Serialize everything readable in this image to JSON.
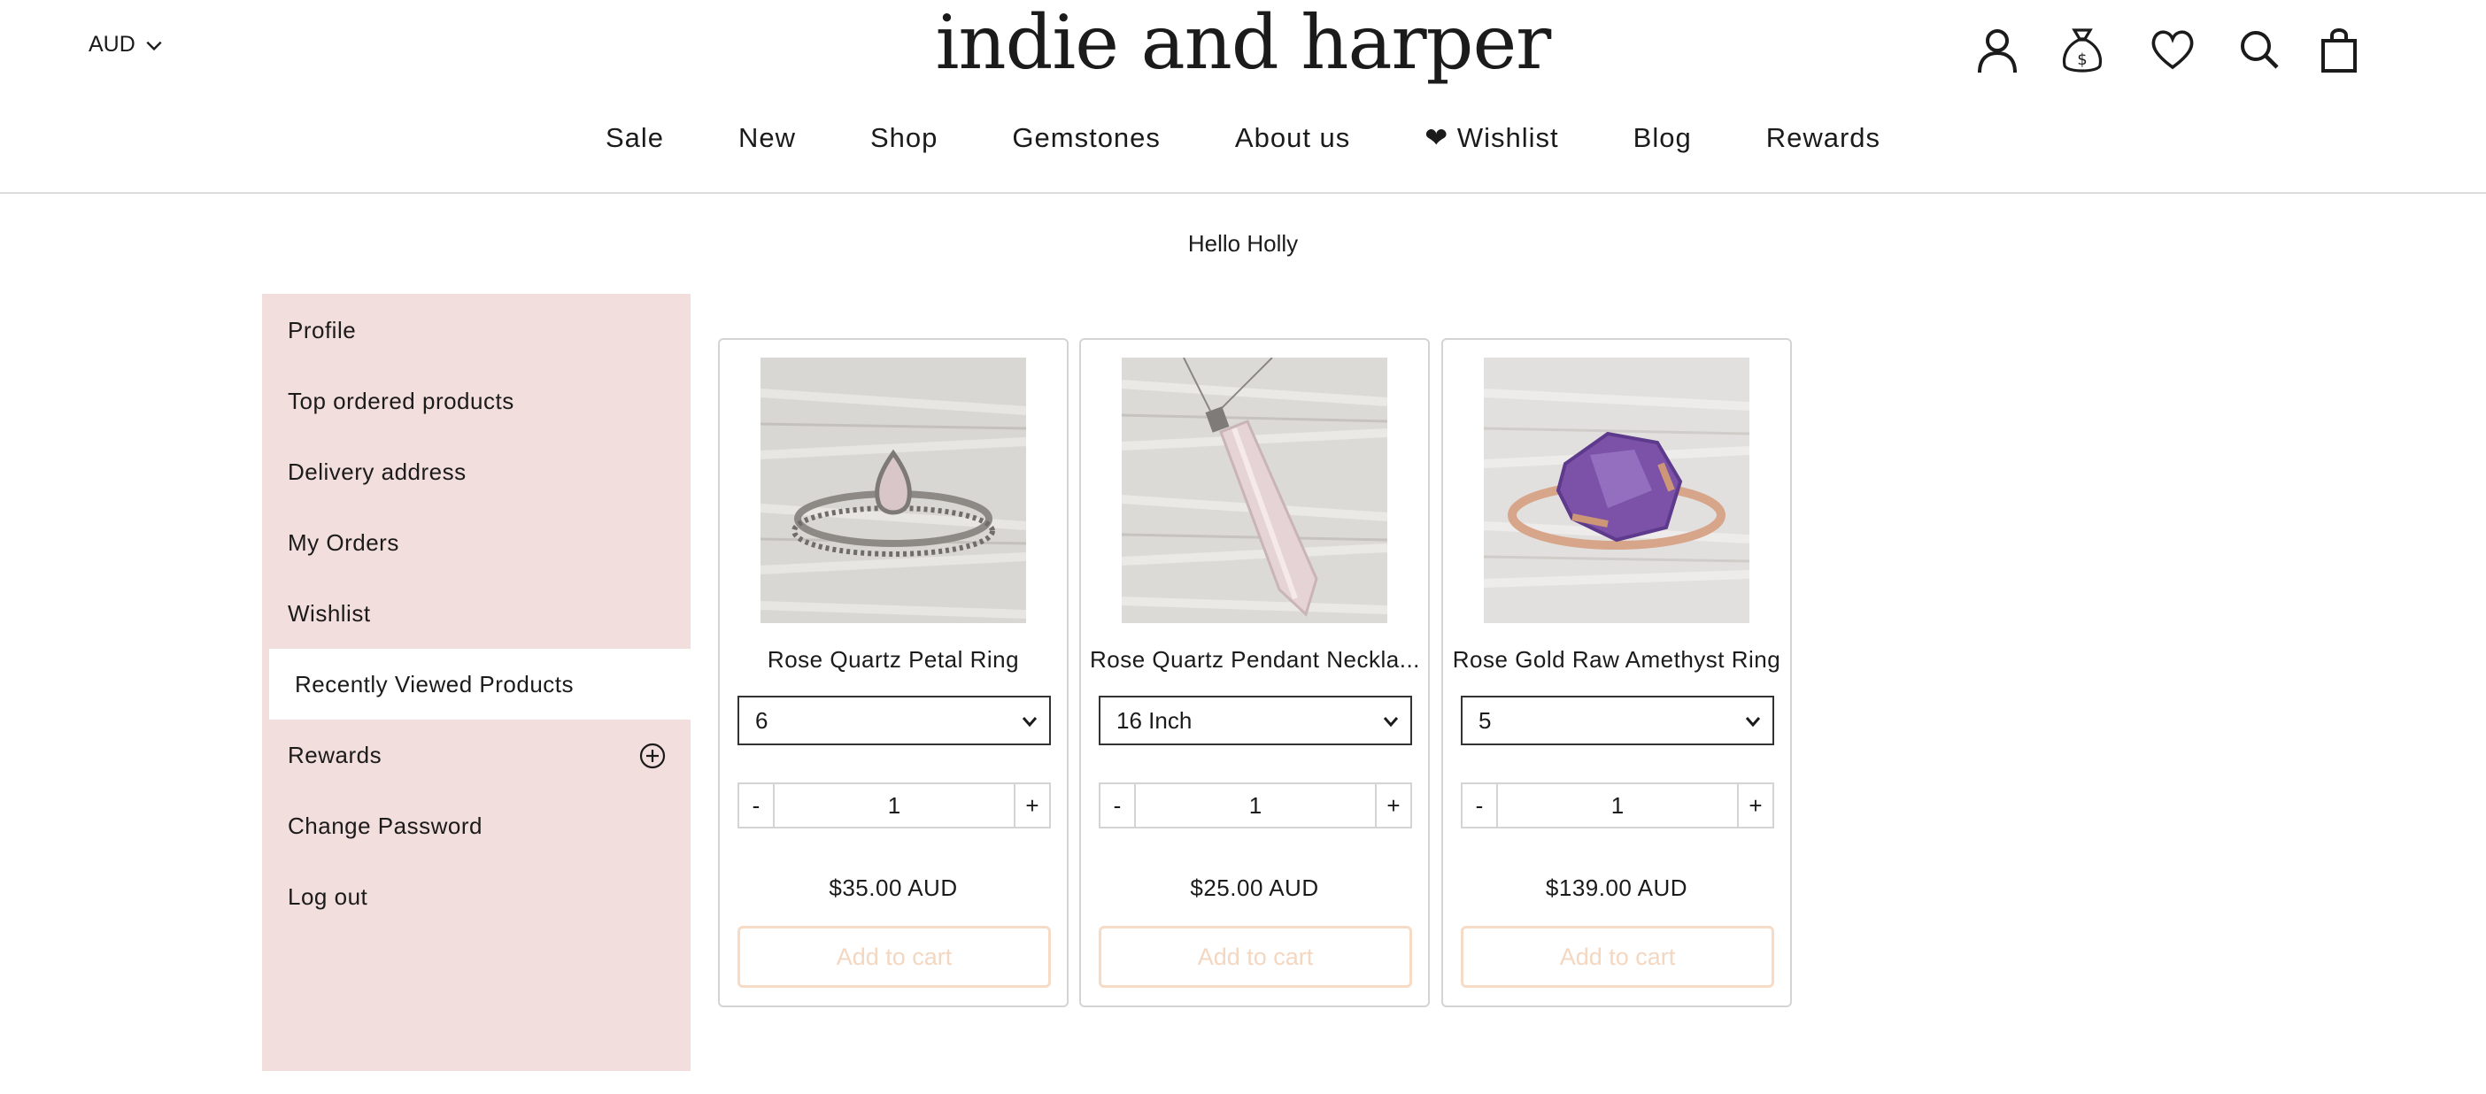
{
  "header": {
    "currency": "AUD",
    "logo": "indie and harper",
    "icons": [
      "account-icon",
      "money-bag-icon",
      "heart-icon",
      "search-icon",
      "shopping-bag-icon"
    ]
  },
  "nav": {
    "items": [
      "Sale",
      "New",
      "Shop",
      "Gemstones",
      "About us",
      "❤ Wishlist",
      "Blog",
      "Rewards"
    ]
  },
  "greeting": "Hello Holly",
  "sidebar": {
    "items": [
      {
        "label": "Profile"
      },
      {
        "label": "Top ordered products"
      },
      {
        "label": "Delivery address"
      },
      {
        "label": "My Orders"
      },
      {
        "label": "Wishlist"
      },
      {
        "label": "Recently Viewed Products",
        "active": true
      },
      {
        "label": "Rewards",
        "icon": "plus-circle-icon"
      },
      {
        "label": "Change Password"
      },
      {
        "label": "Log out"
      }
    ]
  },
  "products": [
    {
      "title": "Rose Quartz Petal Ring",
      "option": "6",
      "quantity": "1",
      "price": "$35.00 AUD",
      "button": "Add to cart"
    },
    {
      "title": "Rose Quartz Pendant Neckla...",
      "option": "16 Inch",
      "quantity": "1",
      "price": "$25.00 AUD",
      "button": "Add to cart"
    },
    {
      "title": "Rose Gold Raw Amethyst Ring",
      "option": "5",
      "quantity": "1",
      "price": "$139.00 AUD",
      "button": "Add to cart"
    }
  ],
  "qty_controls": {
    "minus": "-",
    "plus": "+"
  },
  "colors": {
    "sidebar_bg": "#f2dedc",
    "cart_border": "#f6dcc7",
    "cart_text": "#f3d7c0"
  }
}
